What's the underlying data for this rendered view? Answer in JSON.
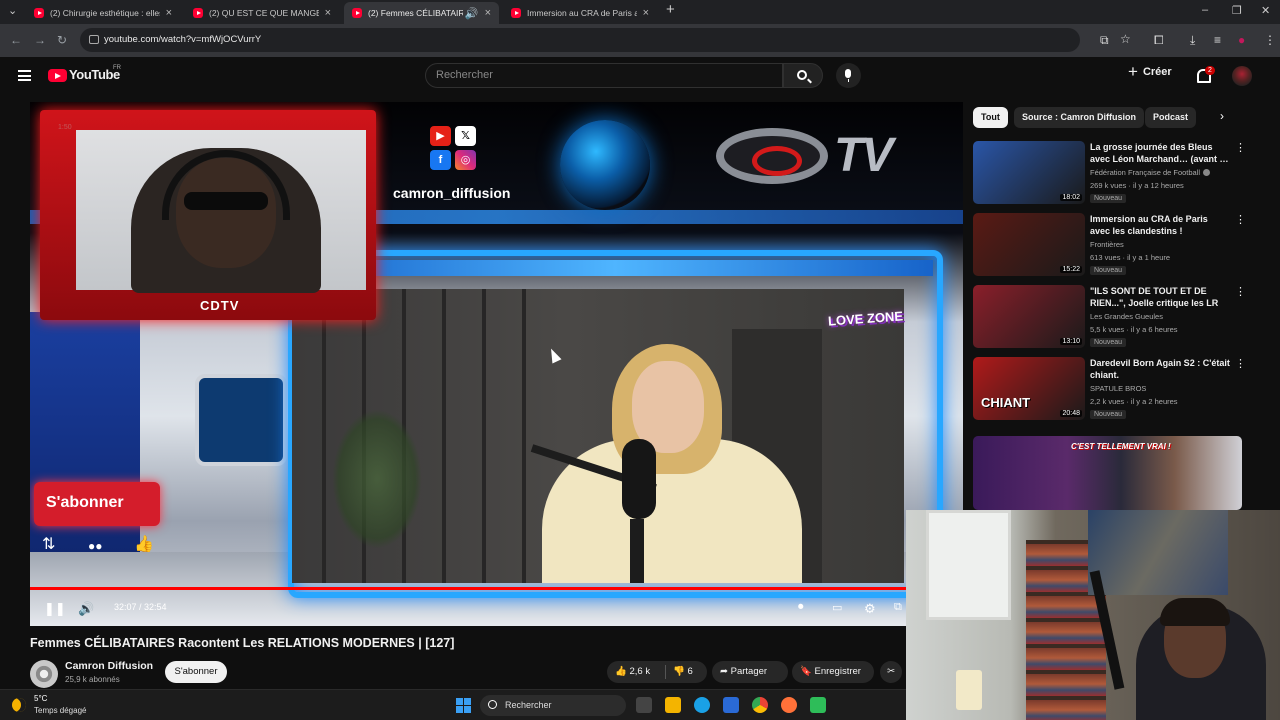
{
  "browser": {
    "tabs": [
      {
        "title": "(2) Chirurgie esthétique : elles r…",
        "active": false
      },
      {
        "title": "(2) QU EST CE QUE MANGE UN…",
        "active": false
      },
      {
        "title": "(2) Femmes CÉLIBATAIRES R…",
        "active": true
      },
      {
        "title": "Immersion au CRA de Paris ave…",
        "active": false
      }
    ],
    "url": "youtube.com/watch?v=mfWjOCVurrY"
  },
  "header": {
    "logo_text": "YouTube",
    "country_code": "FR",
    "search_placeholder": "Rechercher",
    "create_label": "Créer",
    "notification_count": "2"
  },
  "player": {
    "current_time": "32:07 / 32:54",
    "progress_fraction": 0.976,
    "overlay": {
      "handle": "camron_diffusion",
      "tv_text": "TV",
      "cam_label": "CDTV",
      "subscribe_badge": "S'abonner",
      "love_zone": "LOVE ZONE",
      "timestamp": "1:50"
    }
  },
  "video": {
    "title": "Femmes CÉLIBATAIRES Racontent Les RELATIONS MODERNES | [127]",
    "channel": "Camron Diffusion",
    "subscribers": "25,9 k abonnés",
    "subscribe_label": "S'abonner",
    "likes": "2,6 k",
    "dislikes": "6",
    "share_label": "Partager",
    "save_label": "Enregistrer"
  },
  "filters": [
    "Tout",
    "Source : Camron Diffusion",
    "Podcast"
  ],
  "recommendations": [
    {
      "title": "La grosse journée des Bleus avec Léon Marchand… (avant …",
      "channel": "Fédération Française de Football",
      "meta": "269 k vues · il y a 12 heures",
      "badge": "Nouveau",
      "duration": "18:02",
      "thumb_color": "#2a56a8"
    },
    {
      "title": "Immersion au CRA de Paris avec les clandestins !",
      "channel": "Frontières",
      "meta": "613 vues · il y a 1 heure",
      "badge": "Nouveau",
      "duration": "15:22",
      "thumb_color": "#5a1a14"
    },
    {
      "title": "\"ILS SONT DE TOUT ET DE RIEN...\", Joelle critique les LR",
      "channel": "Les Grandes Gueules",
      "meta": "5,5 k vues · il y a 6 heures",
      "badge": "Nouveau",
      "duration": "13:10",
      "thumb_color": "#8a1f2a"
    },
    {
      "title": "Daredevil Born Again S2 : C'était chiant.",
      "channel": "SPATULE BROS",
      "meta": "2,2 k vues · il y a 2 heures",
      "badge": "Nouveau",
      "duration": "20:48",
      "thumb_color": "#b01a1a"
    }
  ],
  "partial_thumb_text": [
    "CHIANT",
    "C'EST TELLEMENT VRAI !"
  ],
  "taskbar": {
    "temperature": "5°C",
    "weather": "Temps dégagé",
    "search_label": "Rechercher"
  }
}
